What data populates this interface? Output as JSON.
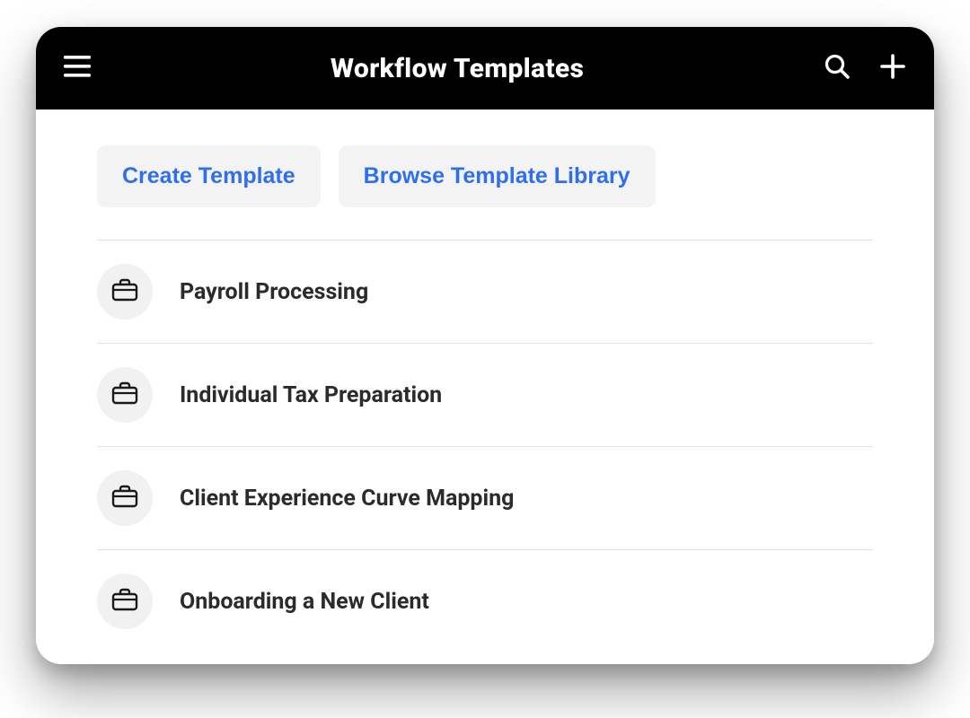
{
  "header": {
    "title": "Workflow Templates"
  },
  "actions": {
    "create": "Create Template",
    "browse": "Browse Template Library"
  },
  "templates": [
    {
      "label": "Payroll Processing"
    },
    {
      "label": "Individual Tax Preparation"
    },
    {
      "label": "Client Experience Curve Mapping"
    },
    {
      "label": "Onboarding a New Client"
    }
  ]
}
